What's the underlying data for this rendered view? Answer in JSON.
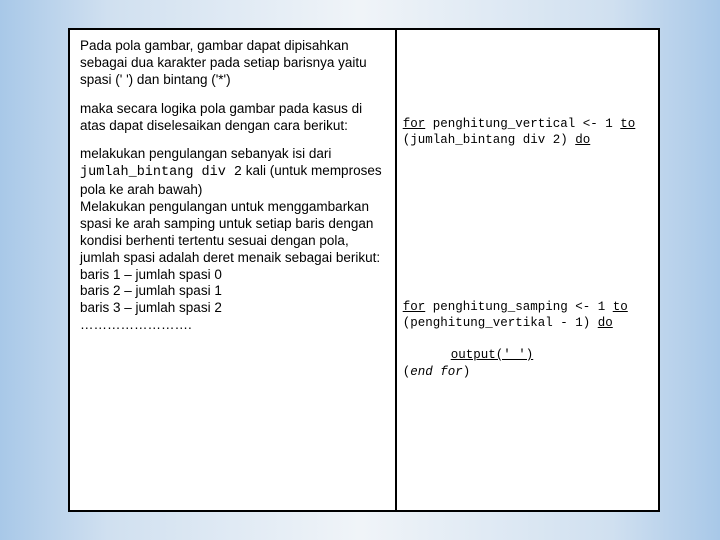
{
  "left": {
    "p1": "Pada pola gambar, gambar dapat dipisahkan sebagai dua karakter pada setiap barisnya yaitu spasi (' ') dan bintang ('*')",
    "p2": "maka secara logika pola gambar pada kasus di atas dapat diselesaikan dengan cara berikut:",
    "p3a": "melakukan pengulangan sebanyak isi dari ",
    "p3code": "jumlah_bintang div 2",
    "p3b": " kali (untuk memproses pola ke arah bawah)",
    "p4": "Melakukan pengulangan untuk menggambarkan spasi ke arah samping untuk setiap baris dengan kondisi berhenti tertentu sesuai dengan pola, jumlah  spasi adalah  deret menaik sebagai berikut:",
    "l1": "baris 1 – jumlah spasi 0",
    "l2": "baris 2 – jumlah spasi 1",
    "l3": "baris 3 – jumlah spasi 2",
    "dots": "……………………."
  },
  "right": {
    "b1": {
      "for": "for",
      "mid1": " penghitung_vertical <- 1 ",
      "to": "to",
      "line2": "(jumlah_bintang div 2) ",
      "do": "do"
    },
    "b2": {
      "for": "for",
      "mid1": " penghitung_samping <- 1 ",
      "to": "to",
      "line2": "(penghitung_vertikal - 1) ",
      "do": "do",
      "out": "output(' ')",
      "end": "(end for)"
    }
  }
}
